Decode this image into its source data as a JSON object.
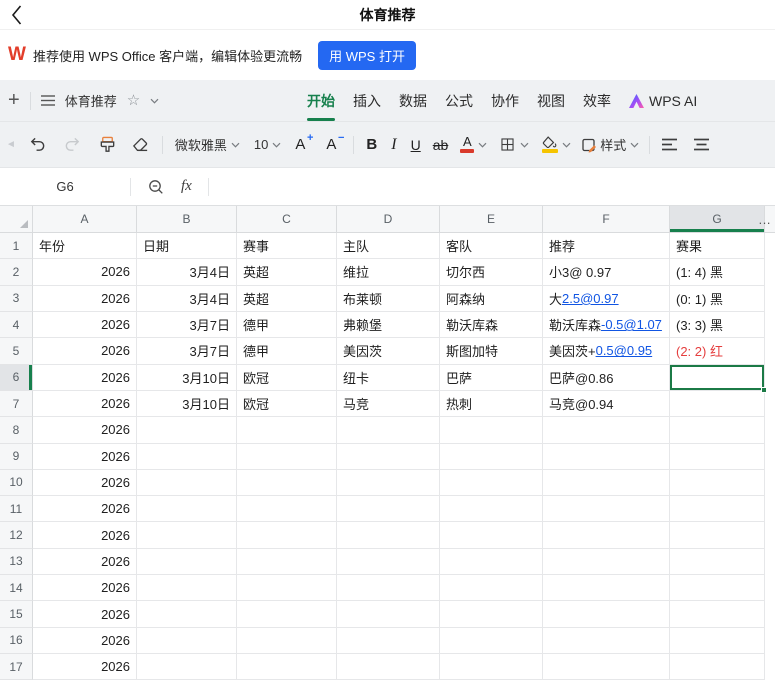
{
  "topbar": {
    "title": "体育推荐"
  },
  "banner": {
    "logo": "W",
    "text": "推荐使用 WPS Office 客户端，编辑体验更流畅",
    "open_button": "用 WPS 打开"
  },
  "docbar": {
    "doc_title": "体育推荐",
    "tabs": [
      {
        "label": "开始",
        "active": true
      },
      {
        "label": "插入"
      },
      {
        "label": "数据"
      },
      {
        "label": "公式"
      },
      {
        "label": "协作"
      },
      {
        "label": "视图"
      },
      {
        "label": "效率"
      }
    ],
    "ai_label": "WPS AI"
  },
  "toolbar": {
    "font_name": "微软雅黑",
    "font_size": "10",
    "bold": "B",
    "italic": "I",
    "underline": "U",
    "strike": "ab",
    "styles_label": "样式"
  },
  "formula_bar": {
    "cell_ref": "G6",
    "fx": "fx"
  },
  "sheet": {
    "columns": [
      "A",
      "B",
      "C",
      "D",
      "E",
      "F",
      "G"
    ],
    "more_indicator": "…",
    "selected": {
      "ref": "G6",
      "row": 6,
      "col": "G"
    },
    "rows": [
      [
        {
          "v": "年份"
        },
        {
          "v": "日期"
        },
        {
          "v": "赛事"
        },
        {
          "v": "主队"
        },
        {
          "v": "客队"
        },
        {
          "v": "推荐"
        },
        {
          "v": "赛果"
        }
      ],
      [
        {
          "v": "2026",
          "align": "r"
        },
        {
          "v": "3月4日",
          "align": "r"
        },
        {
          "v": "英超"
        },
        {
          "v": "维拉"
        },
        {
          "v": "切尔西"
        },
        {
          "v": "小3@ 0.97"
        },
        {
          "v": "(1: 4) 黑"
        }
      ],
      [
        {
          "v": "2026",
          "align": "r"
        },
        {
          "v": "3月4日",
          "align": "r"
        },
        {
          "v": "英超"
        },
        {
          "v": "布莱顿"
        },
        {
          "v": "阿森纳"
        },
        {
          "parts": [
            {
              "v": "大"
            },
            {
              "v": "2.5@0.97",
              "link": true
            }
          ]
        },
        {
          "v": "(0: 1) 黑"
        }
      ],
      [
        {
          "v": "2026",
          "align": "r"
        },
        {
          "v": "3月7日",
          "align": "r"
        },
        {
          "v": "德甲"
        },
        {
          "v": "弗赖堡"
        },
        {
          "v": "勒沃库森"
        },
        {
          "parts": [
            {
              "v": "勒沃库森"
            },
            {
              "v": "-0.5@1.07",
              "link": true
            }
          ]
        },
        {
          "v": "(3: 3) 黑"
        }
      ],
      [
        {
          "v": "2026",
          "align": "r"
        },
        {
          "v": "3月7日",
          "align": "r"
        },
        {
          "v": "德甲"
        },
        {
          "v": "美因茨"
        },
        {
          "v": "斯图加特"
        },
        {
          "parts": [
            {
              "v": "美因茨+"
            },
            {
              "v": "0.5@0.95",
              "link": true
            }
          ]
        },
        {
          "v": "(2: 2) 红",
          "red": true
        }
      ],
      [
        {
          "v": "2026",
          "align": "r"
        },
        {
          "v": "3月10日",
          "align": "r"
        },
        {
          "v": "欧冠"
        },
        {
          "v": "纽卡"
        },
        {
          "v": "巴萨"
        },
        {
          "v": "巴萨@0.86"
        },
        {
          "v": ""
        }
      ],
      [
        {
          "v": "2026",
          "align": "r"
        },
        {
          "v": "3月10日",
          "align": "r"
        },
        {
          "v": "欧冠"
        },
        {
          "v": "马竞"
        },
        {
          "v": "热刺"
        },
        {
          "v": "马竞@0.94"
        },
        {
          "v": ""
        }
      ],
      [
        {
          "v": "2026",
          "align": "r"
        },
        {
          "v": ""
        },
        {
          "v": ""
        },
        {
          "v": ""
        },
        {
          "v": ""
        },
        {
          "v": ""
        },
        {
          "v": ""
        }
      ],
      [
        {
          "v": "2026",
          "align": "r"
        },
        {
          "v": ""
        },
        {
          "v": ""
        },
        {
          "v": ""
        },
        {
          "v": ""
        },
        {
          "v": ""
        },
        {
          "v": ""
        }
      ],
      [
        {
          "v": "2026",
          "align": "r"
        },
        {
          "v": ""
        },
        {
          "v": ""
        },
        {
          "v": ""
        },
        {
          "v": ""
        },
        {
          "v": ""
        },
        {
          "v": ""
        }
      ],
      [
        {
          "v": "2026",
          "align": "r"
        },
        {
          "v": ""
        },
        {
          "v": ""
        },
        {
          "v": ""
        },
        {
          "v": ""
        },
        {
          "v": ""
        },
        {
          "v": ""
        }
      ],
      [
        {
          "v": "2026",
          "align": "r"
        },
        {
          "v": ""
        },
        {
          "v": ""
        },
        {
          "v": ""
        },
        {
          "v": ""
        },
        {
          "v": ""
        },
        {
          "v": ""
        }
      ],
      [
        {
          "v": "2026",
          "align": "r"
        },
        {
          "v": ""
        },
        {
          "v": ""
        },
        {
          "v": ""
        },
        {
          "v": ""
        },
        {
          "v": ""
        },
        {
          "v": ""
        }
      ],
      [
        {
          "v": "2026",
          "align": "r"
        },
        {
          "v": ""
        },
        {
          "v": ""
        },
        {
          "v": ""
        },
        {
          "v": ""
        },
        {
          "v": ""
        },
        {
          "v": ""
        }
      ],
      [
        {
          "v": "2026",
          "align": "r"
        },
        {
          "v": ""
        },
        {
          "v": ""
        },
        {
          "v": ""
        },
        {
          "v": ""
        },
        {
          "v": ""
        },
        {
          "v": ""
        }
      ],
      [
        {
          "v": "2026",
          "align": "r"
        },
        {
          "v": ""
        },
        {
          "v": ""
        },
        {
          "v": ""
        },
        {
          "v": ""
        },
        {
          "v": ""
        },
        {
          "v": ""
        }
      ],
      [
        {
          "v": "2026",
          "align": "r"
        },
        {
          "v": ""
        },
        {
          "v": ""
        },
        {
          "v": ""
        },
        {
          "v": ""
        },
        {
          "v": ""
        },
        {
          "v": ""
        }
      ]
    ]
  },
  "colors": {
    "accent_green": "#17804d",
    "selection_green": "#1b7a46",
    "link_blue": "#1155e3",
    "result_red": "#e53e3e",
    "button_blue": "#2468f2",
    "logo_red": "#e23e2b",
    "font_color_red": "#d93a2b",
    "fill_color_yellow": "#f5c400",
    "ai_gradient": [
      "#2f6bff",
      "#a44cf6",
      "#ff5fa8"
    ]
  }
}
